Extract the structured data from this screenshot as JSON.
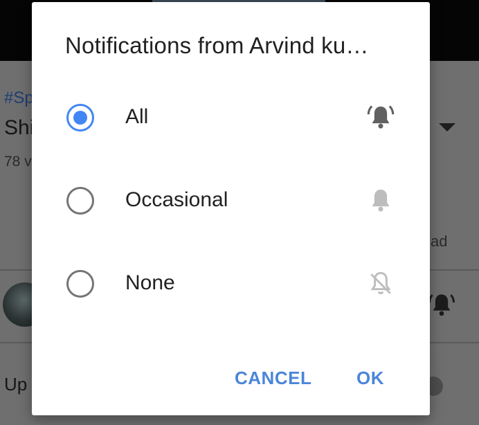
{
  "background": {
    "hashtag_partial": "#Sp",
    "title_partial": "Shi",
    "views_partial": "78 v",
    "ad_partial": "ad",
    "up_next_partial": "Up"
  },
  "dialog": {
    "title": "Notifications from Arvind ku…",
    "options": [
      {
        "label": "All",
        "selected": true,
        "icon": "bell-ringing-icon"
      },
      {
        "label": "Occasional",
        "selected": false,
        "icon": "bell-icon"
      },
      {
        "label": "None",
        "selected": false,
        "icon": "bell-off-icon"
      }
    ],
    "cancel_label": "CANCEL",
    "ok_label": "OK"
  },
  "colors": {
    "accent": "#4286f4",
    "button_text": "#4a86d9",
    "scrim": "#6f6f6f"
  }
}
